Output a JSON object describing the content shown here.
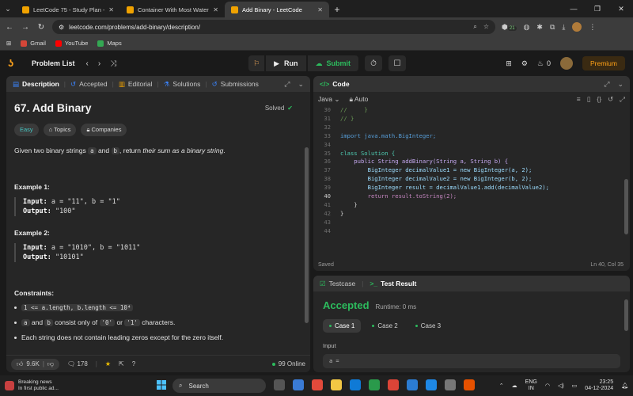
{
  "browser": {
    "tabs": [
      {
        "label": "LeetCode 75 - Study Plan - Leetc",
        "active": false
      },
      {
        "label": "Container With Most Water - Le",
        "active": false
      },
      {
        "label": "Add Binary - LeetCode",
        "active": true
      }
    ],
    "url": "leetcode.com/problems/add-binary/description/",
    "bookmarks": [
      "Gmail",
      "YouTube",
      "Maps"
    ],
    "ext_badge": "21"
  },
  "header": {
    "problem_list": "Problem List",
    "run": "Run",
    "submit": "Submit",
    "streak_count": "0",
    "premium": "Premium"
  },
  "description_panel": {
    "tabs": [
      "Description",
      "Accepted",
      "Editorial",
      "Solutions",
      "Submissions"
    ],
    "title": "67. Add Binary",
    "status": "Solved",
    "tags": [
      "Easy",
      "Topics",
      "Companies"
    ],
    "statement_pre": "Given two binary strings ",
    "statement_a": "a",
    "statement_and": " and ",
    "statement_b": "b",
    "statement_mid": ", return ",
    "statement_em": "their sum as a binary string",
    "statement_end": ".",
    "example1_title": "Example 1:",
    "example1_input_label": "Input:",
    "example1_input": " a = \"11\", b = \"1\"",
    "example1_output_label": "Output:",
    "example1_output": " \"100\"",
    "example2_title": "Example 2:",
    "example2_input_label": "Input:",
    "example2_input": " a = \"1010\", b = \"1011\"",
    "example2_output_label": "Output:",
    "example2_output": " \"10101\"",
    "constraints_title": "Constraints:",
    "constraint1": "1 <= a.length, b.length <= 10⁴",
    "constraint2_a": "a",
    "constraint2_and": " and ",
    "constraint2_b": "b",
    "constraint2_text": " consist only of ",
    "constraint2_zero": "'0'",
    "constraint2_or": " or ",
    "constraint2_one": "'1'",
    "constraint2_end": " characters.",
    "constraint3": "Each string does not contain leading zeros except for the zero itself.",
    "likes": "9.6K",
    "comments": "178",
    "online": "99 Online"
  },
  "code_panel": {
    "title": "Code",
    "language": "Java",
    "mode": "Auto",
    "status_left": "Saved",
    "status_right": "Ln 40, Col 35",
    "lines": [
      {
        "n": "30",
        "t": "//     }"
      },
      {
        "n": "31",
        "t": "// }"
      },
      {
        "n": "32",
        "t": ""
      },
      {
        "n": "33",
        "t": "import java.math.BigInteger;"
      },
      {
        "n": "34",
        "t": ""
      },
      {
        "n": "35",
        "t": "class Solution {"
      },
      {
        "n": "36",
        "t": "    public String addBinary(String a, String b) {"
      },
      {
        "n": "37",
        "t": "        BigInteger decimalValue1 = new BigInteger(a, 2);"
      },
      {
        "n": "38",
        "t": "        BigInteger decimalValue2 = new BigInteger(b, 2);"
      },
      {
        "n": "39",
        "t": "        BigInteger result = decimalValue1.add(decimalValue2);"
      },
      {
        "n": "40",
        "t": "        return result.toString(2);"
      },
      {
        "n": "41",
        "t": "    }"
      },
      {
        "n": "42",
        "t": "}"
      },
      {
        "n": "43",
        "t": ""
      },
      {
        "n": "44",
        "t": ""
      }
    ]
  },
  "test_panel": {
    "tab_testcase": "Testcase",
    "tab_result": "Test Result",
    "verdict": "Accepted",
    "runtime": "Runtime: 0 ms",
    "cases": [
      "Case 1",
      "Case 2",
      "Case 3"
    ],
    "input_label": "Input",
    "input_value": "a ="
  },
  "taskbar": {
    "news_title": "Breaking news",
    "news_sub": "In first public ad...",
    "search": "Search",
    "lang": "ENG",
    "region": "IN",
    "time": "23:25",
    "date": "04-12-2024"
  }
}
